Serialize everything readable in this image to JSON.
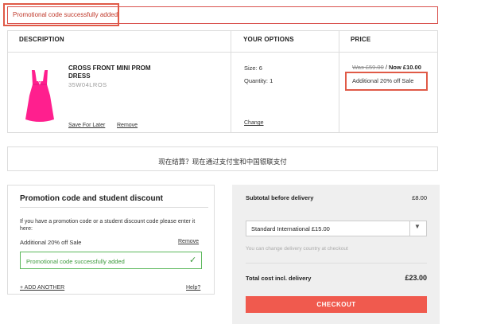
{
  "notice": {
    "text": "Promotional code successfully added"
  },
  "table": {
    "headers": {
      "description": "DESCRIPTION",
      "options": "YOUR OPTIONS",
      "price": "PRICE"
    },
    "item": {
      "title": "CROSS FRONT MINI PROM DRESS",
      "code": "35W04LROS",
      "save_for_later": "Save For Later",
      "remove": "Remove",
      "size": "Size: 6",
      "quantity": "Quantity: 1",
      "change": "Change",
      "was_price": "Was £59.00",
      "separator": " / ",
      "now_price": "Now £10.00",
      "sale_note": "Additional 20% off Sale",
      "image_color": "#ff1f8e"
    }
  },
  "payment_banner": {
    "text": "现在结算？现在通过支付宝和中国银联支付"
  },
  "promo": {
    "title": "Promotion code and student discount",
    "description": "If you have a promotion code or a student discount code please enter it here:",
    "applied_item": "Additional 20% off Sale",
    "remove": "Remove",
    "success": "Promotional code successfully added",
    "check_icon": "✓",
    "add_another": "+ ADD ANOTHER",
    "help": "Help?"
  },
  "summary": {
    "subtotal_label": "Subtotal before delivery",
    "subtotal_value": "£8.00",
    "delivery_option": "Standard International £15.00",
    "delivery_note": "You can change delivery country at checkout",
    "total_label": "Total cost incl. delivery",
    "total_value": "£23.00",
    "checkout_label": "CHECKOUT"
  },
  "colors": {
    "highlight": "#e05a47",
    "success": "#5cb85c",
    "checkout": "#f05a4e"
  }
}
